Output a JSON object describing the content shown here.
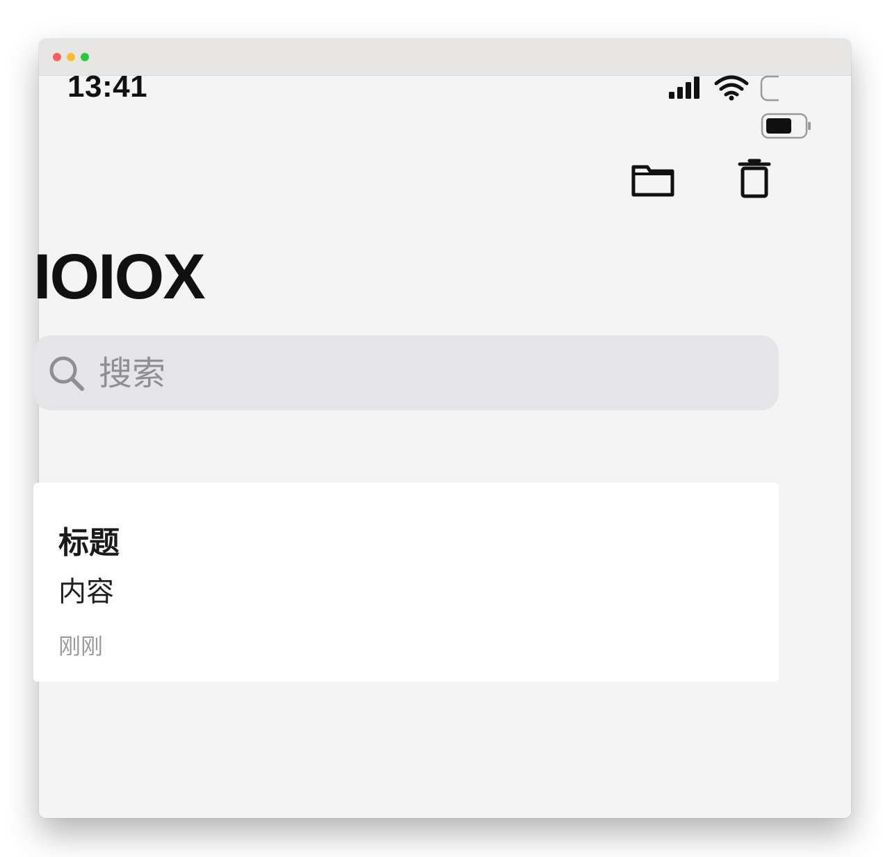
{
  "status_bar": {
    "time": "13:41",
    "icons": [
      "signal-icon",
      "wifi-icon",
      "battery-icon"
    ]
  },
  "toolbar": {
    "folder_icon": "folder-icon",
    "trash_icon": "trash-icon"
  },
  "header": {
    "title": "IOIOX"
  },
  "search": {
    "placeholder": "搜索",
    "value": "",
    "icon": "search-icon"
  },
  "notes": [
    {
      "title": "标题",
      "content": "内容",
      "time": "刚刚"
    }
  ],
  "colors": {
    "background": "#f4f4f4",
    "search_bg": "#e4e4e9",
    "card_bg": "#ffffff",
    "text_primary": "#111111",
    "text_secondary": "#9a9a9a",
    "placeholder": "#8e8e93"
  }
}
